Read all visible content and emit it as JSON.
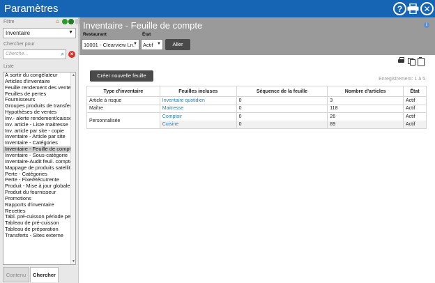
{
  "window": {
    "title": "Paramètres"
  },
  "left": {
    "filter_label": "Filtre",
    "filter_value": "Inventaire",
    "search_label": "Chercher pour",
    "search_placeholder": "Cherche...",
    "list_label": "Liste",
    "items": [
      "À sortir du congélateur",
      "Articles d'inventaire",
      "Feuille rendement des ventes",
      "Feuilles de pertes",
      "Fournisseurs",
      "Groupes produits de transfert",
      "Hypothèses de ventes",
      "Inv.- alerte rendement/caisse",
      "Inv. article - Liste maitresse",
      "Inv. article par site - copie",
      "Inventaire - Article par site",
      "Inventaire - Catégories",
      "Inventaire - Feuille de compte",
      "Inventaire - Sous-catégorie",
      "Inventaire-Audit feuil. compte",
      "Mappage de produits satellites",
      "Perte - Catégories",
      "Perte - Fixe/Récurrente",
      "Produit - Mise à jour globale",
      "Produit du fournisseur",
      "Promotions",
      "Rapports d'inventaire",
      "Recettes",
      "Tabl. pré-cuisson période per",
      "Tableau de pré-cuisson",
      "Tableau de préparation",
      "Transferts - Sites externe"
    ],
    "selected_index": 12,
    "tabs": {
      "contenu": "Contenu",
      "chercher": "Chercher"
    }
  },
  "main": {
    "title": "Inventaire - Feuille de compte",
    "restaurant_label": "Restaurant",
    "restaurant_value": "10001 - Clearview Ln.",
    "etat_label": "État",
    "etat_value": "Actif",
    "go_label": "Aller",
    "create_label": "Créer nouvelle feuille",
    "records": "Enregistrement: 1 à 5",
    "table": {
      "headers": {
        "type": "Type d'inventaire",
        "feuilles": "Feuilles incluses",
        "sequence": "Séquence de la feuille",
        "nombre": "Nombre d'articles",
        "etat": "État"
      },
      "groups": [
        {
          "type": "Article à risque",
          "rows": [
            {
              "feuille": "Inventaire quotidien",
              "sequence": "0",
              "nombre": "3",
              "etat": "Actif"
            }
          ]
        },
        {
          "type": "Maître",
          "rows": [
            {
              "feuille": "Maitresse",
              "sequence": "0",
              "nombre": "118",
              "etat": "Actif"
            }
          ]
        },
        {
          "type": "Personnalisée",
          "rows": [
            {
              "feuille": "Comptoir",
              "sequence": "0",
              "nombre": "26",
              "etat": "Actif"
            },
            {
              "feuille": "Cuisine",
              "sequence": "0",
              "nombre": "89",
              "etat": "Actif"
            }
          ]
        }
      ]
    }
  }
}
